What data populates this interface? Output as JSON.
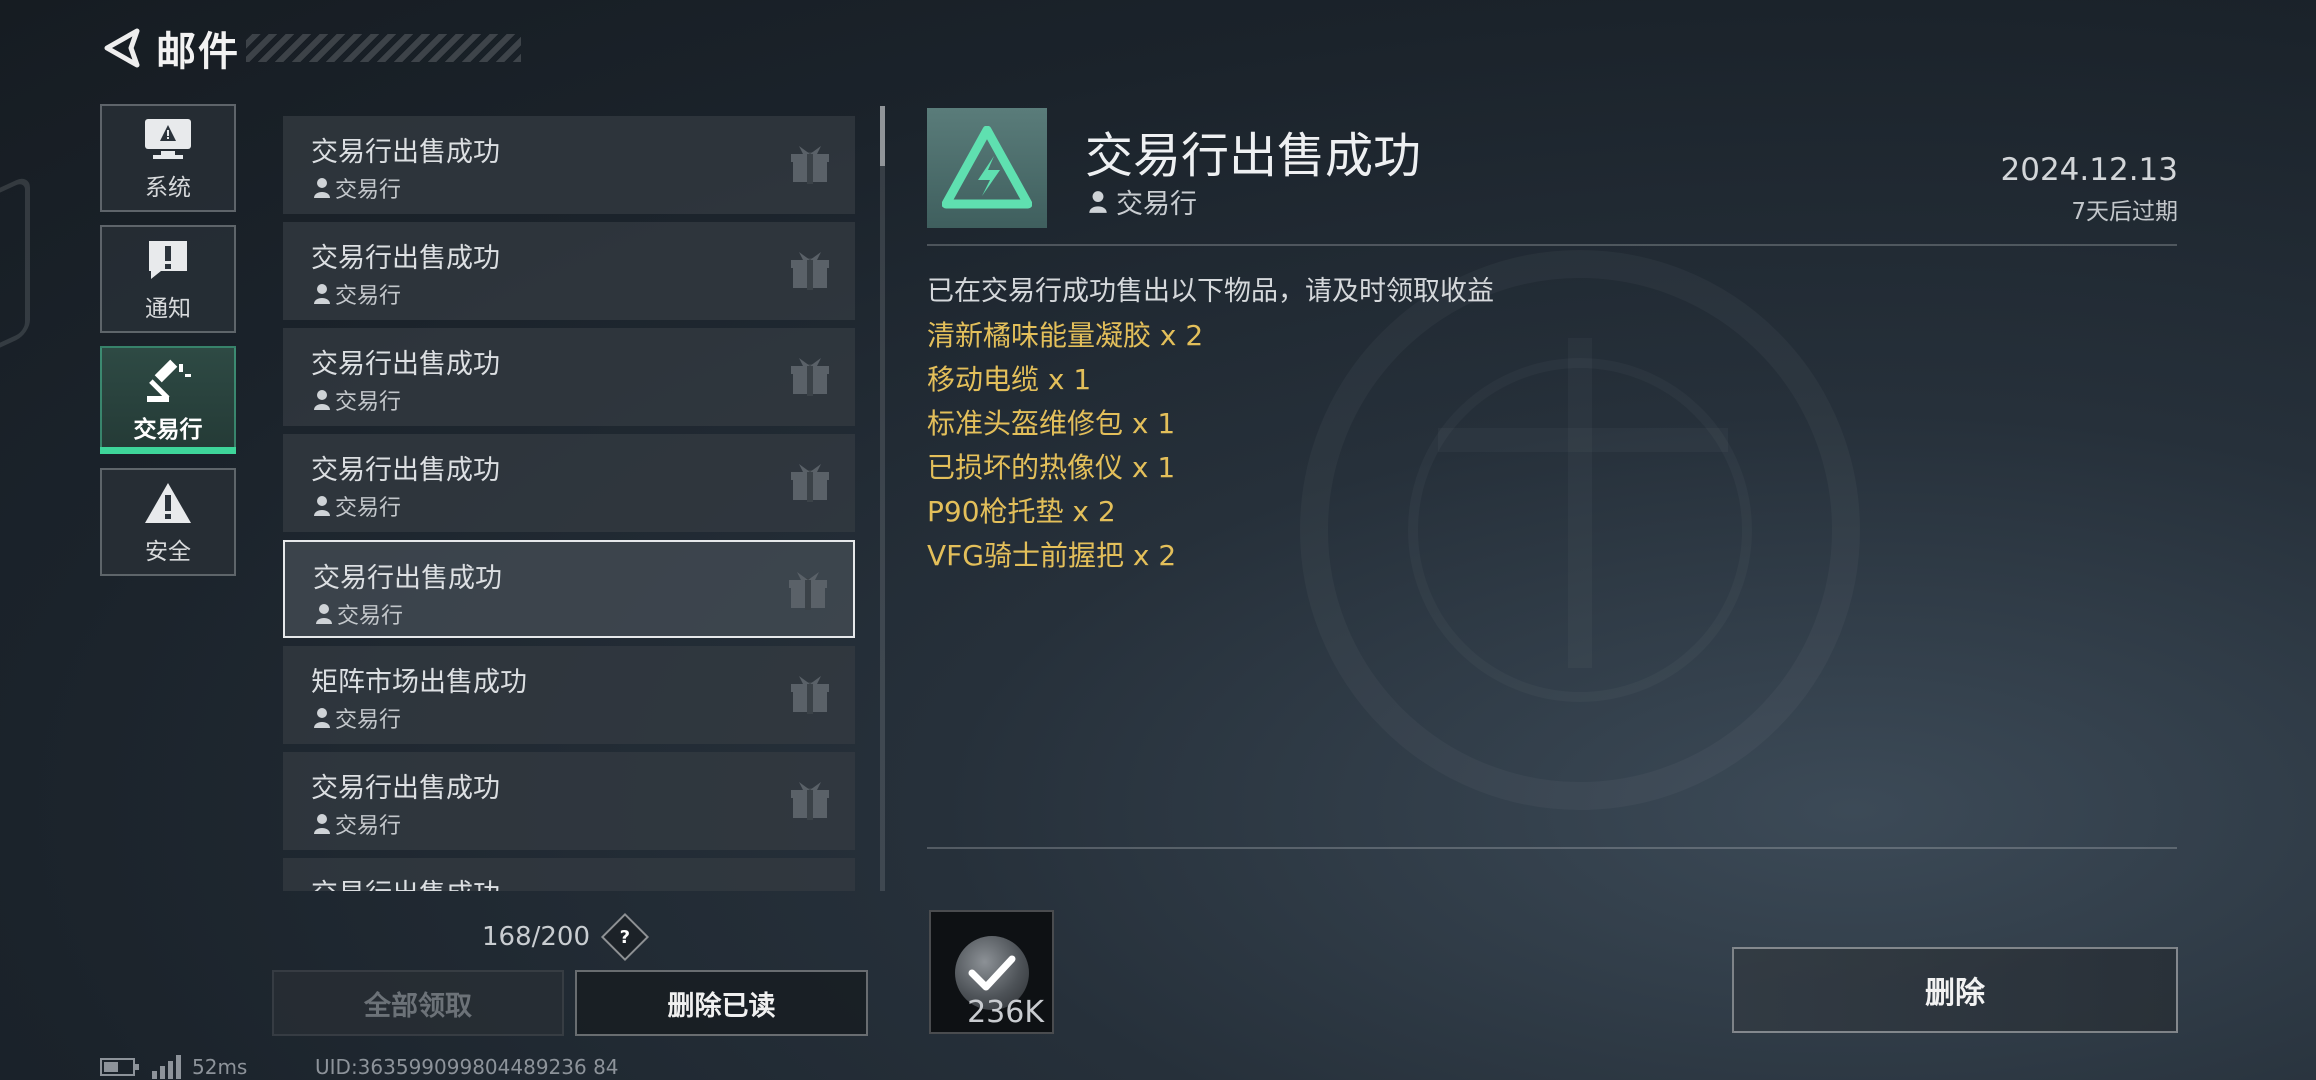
{
  "header": {
    "title": "邮件"
  },
  "categories": [
    {
      "label": "系统"
    },
    {
      "label": "通知"
    },
    {
      "label": "交易行"
    },
    {
      "label": "安全"
    }
  ],
  "mail_list": [
    {
      "subject": "交易行出售成功",
      "sender": "交易行"
    },
    {
      "subject": "交易行出售成功",
      "sender": "交易行"
    },
    {
      "subject": "交易行出售成功",
      "sender": "交易行"
    },
    {
      "subject": "交易行出售成功",
      "sender": "交易行"
    },
    {
      "subject": "交易行出售成功",
      "sender": "交易行"
    },
    {
      "subject": "矩阵市场出售成功",
      "sender": "交易行"
    },
    {
      "subject": "交易行出售成功",
      "sender": "交易行"
    },
    {
      "subject": "交易行出售成功",
      "sender": ""
    }
  ],
  "mail_count": "168/200",
  "help": "?",
  "buttons": {
    "claim_all": "全部领取",
    "delete_read": "删除已读",
    "delete": "删除"
  },
  "detail": {
    "title": "交易行出售成功",
    "sender": "交易行",
    "date": "2024.12.13",
    "expiry": "7天后过期",
    "intro": "已在交易行成功售出以下物品，请及时领取收益",
    "items": [
      "清新橘味能量凝胶 x 2",
      "移动电缆 x 1",
      "标准头盔维修包 x 1",
      "已损坏的热像仪 x 1",
      "P90枪托垫 x 2",
      "VFG骑士前握把 x 2"
    ],
    "attachment_qty": "236K"
  },
  "status": {
    "ping": "52ms",
    "uid": "UID:363599099804489236 84"
  },
  "colors": {
    "accent": "#3ed59a",
    "reward": "#e3bf5a"
  }
}
